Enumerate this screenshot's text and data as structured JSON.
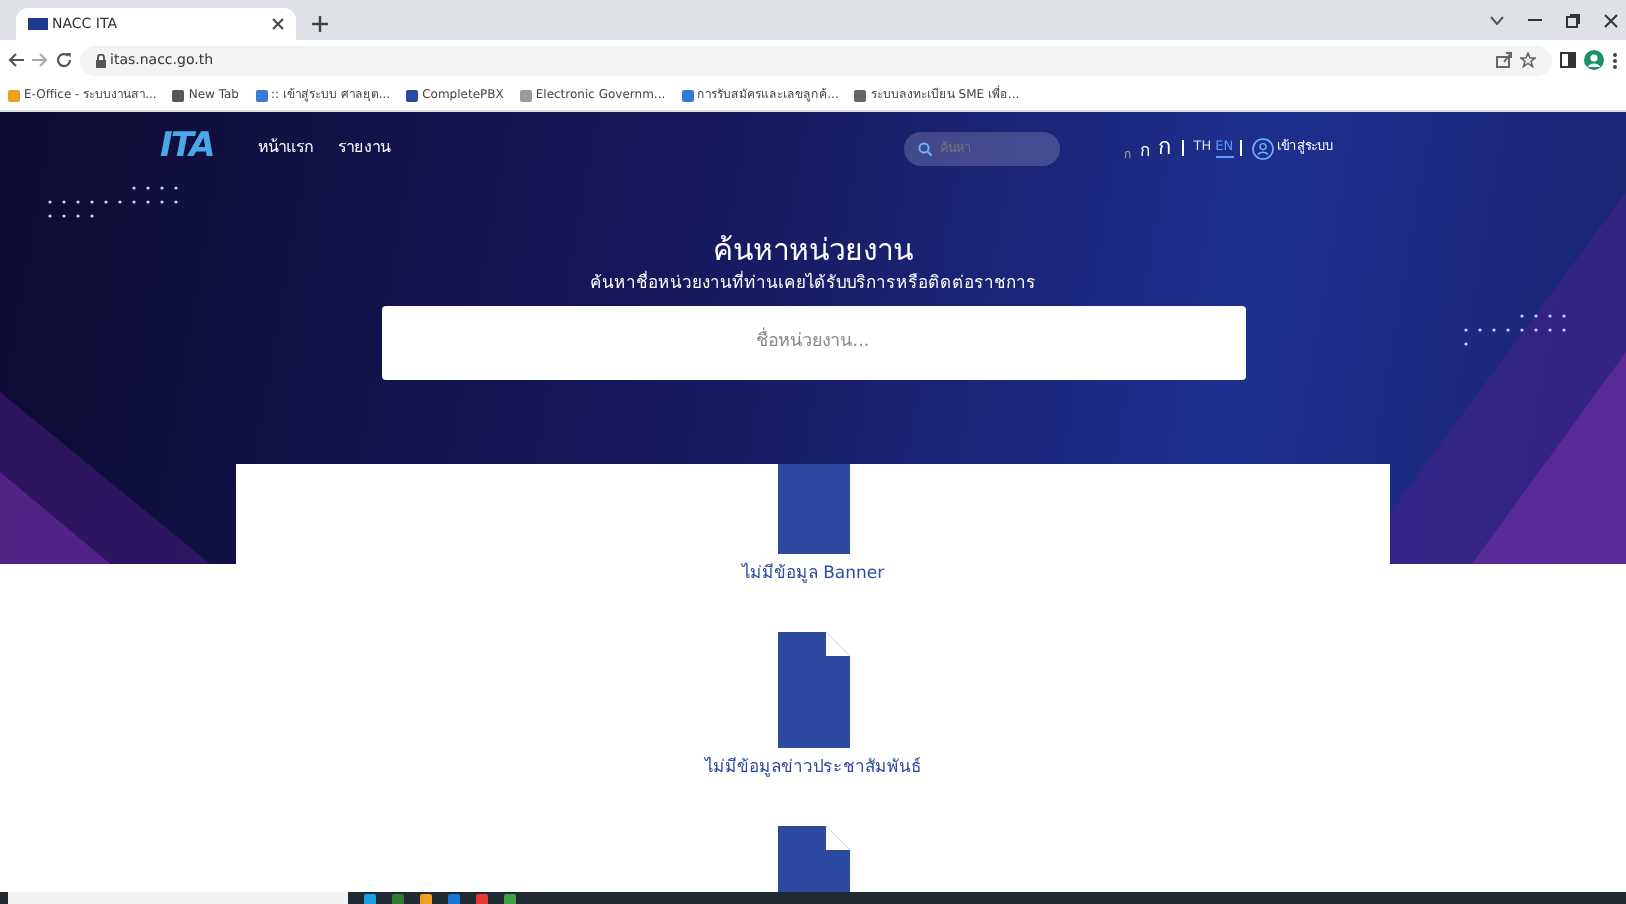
{
  "browser": {
    "tab_title": "NACC ITA",
    "url": "itas.nacc.go.th",
    "bookmarks": [
      {
        "label": "E-Office - ระบบงานสา..."
      },
      {
        "label": "New Tab"
      },
      {
        "label": ":: เข้าสู่ระบบ ศาลยุต..."
      },
      {
        "label": "CompletePBX"
      },
      {
        "label": "Electronic Governm..."
      },
      {
        "label": "การรับสมัครและเลขลูกค้..."
      },
      {
        "label": "ระบบลงทะเบียน SME เพื่อ..."
      }
    ]
  },
  "site": {
    "logo": "ITA",
    "nav_items": [
      {
        "label": "หน้าแรก"
      },
      {
        "label": "รายงาน"
      }
    ],
    "search_placeholder": "ค้นหา",
    "font_sizes": [
      "ก",
      "ก",
      "ก"
    ],
    "languages": [
      {
        "label": "TH",
        "selected": false
      },
      {
        "label": "EN",
        "selected": true
      }
    ],
    "login": "เข้าสู่ระบบ"
  },
  "hero": {
    "title": "ค้นหาหน่วยงาน",
    "subtitle": "ค้นหาชื่อหน่วยงานที่ท่านเคยได้รับบริการหรือติดต่อราชการ",
    "search_placeholder": "ชื่อหน่วยงาน..."
  },
  "content": [
    {
      "kind": "notice",
      "text": "ไม่มีข้อมูล Banner"
    },
    {
      "kind": "notice",
      "text": "ไม่มีข้อมูลข่าวประชาสัมพันธ์"
    },
    {
      "kind": "icon"
    }
  ]
}
